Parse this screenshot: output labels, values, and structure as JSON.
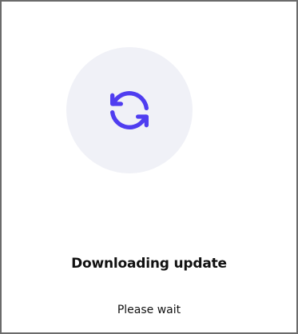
{
  "dialog": {
    "icon": "refresh-icon",
    "title": "Downloading update",
    "subtitle": "Please wait"
  },
  "colors": {
    "accent": "#4f3df0",
    "icon_background": "#f0f1f7",
    "border": "#6b6b6b",
    "text": "#111111"
  }
}
